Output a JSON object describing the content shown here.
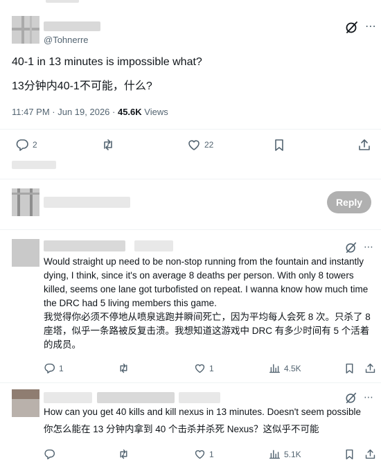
{
  "post": {
    "handle": "@Tohnerre",
    "text_en": "40-1 in 13 minutes is impossible what?",
    "text_cn": "13分钟内40-1不可能，什么?",
    "time": "11:47 PM · Jun 19, 2026 · ",
    "views_count": "45.6K",
    "views_label": " Views",
    "replies": "2",
    "likes": "22"
  },
  "composer": {
    "reply_label": "Reply"
  },
  "comments": [
    {
      "text_en": "Would straight up need to be non-stop running from the fountain and instantly dying, I think, since it's on average 8 deaths per person. With only 8 towers killed, seems one lane got turbofisted on repeat. I wanna know how much time the DRC had 5 living members this game.",
      "text_cn": "我觉得你必须不停地从喷泉逃跑并瞬间死亡，因为平均每人会死 8 次。只杀了 8 座塔，似乎一条路被反复击溃。我想知道这游戏中 DRC 有多少时间有 5 个活着的成员。",
      "replies": "1",
      "likes": "1",
      "views": "4.5K"
    },
    {
      "text_en": "How can you get 40 kills and kill nexus in 13 minutes. Doesn't seem possible",
      "text_cn": "你怎么能在 13 分钟内拿到 40 个击杀并杀死 Nexus？这似乎不可能",
      "replies": "",
      "likes": "1",
      "views": "5.1K"
    }
  ]
}
